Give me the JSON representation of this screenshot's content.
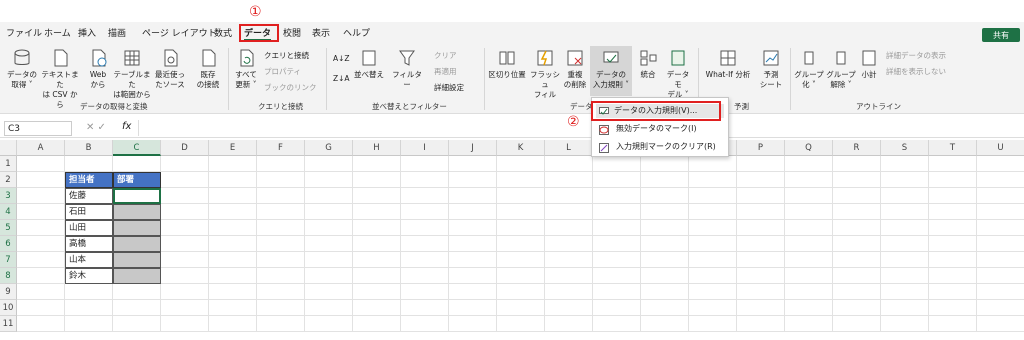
{
  "annotations": {
    "step1": "①",
    "step2": "②"
  },
  "menu": [
    "ファイル",
    "ホーム",
    "挿入",
    "描画",
    "ページ レイアウト",
    "数式",
    "データ",
    "校閲",
    "表示",
    "ヘルプ"
  ],
  "share_label": "共有",
  "ribbon": {
    "get_data": [
      "データの",
      "取得 ˅"
    ],
    "text_csv": [
      "テキストまた",
      "は CSV から"
    ],
    "web": [
      "Web",
      "から"
    ],
    "table_range": [
      "テーブルまた",
      "は範囲から"
    ],
    "recent": [
      "最近使っ",
      "たソース"
    ],
    "existing": [
      "既存",
      "の接続"
    ],
    "refresh": [
      "すべて",
      "更新 ˅"
    ],
    "queries": "クエリと接続",
    "properties": "プロパティ",
    "workbook_links": "ブックのリンク",
    "sort_az": "A↓Z",
    "sort_za": "Z↓A",
    "sort": "並べ替え",
    "filter": "フィルター",
    "clear": "クリア",
    "reapply": "再適用",
    "advanced": "詳細設定",
    "text_to_columns": "区切り位置",
    "flash_fill": [
      "フラッシュ",
      "フィル"
    ],
    "remove_dup": [
      "重複",
      "の削除"
    ],
    "validation": [
      "データの",
      "入力規則 ˅"
    ],
    "consolidate": "統合",
    "data_model": [
      "データ モ",
      "デル ˅"
    ],
    "whatif": "What-If 分析",
    "forecast": [
      "予測",
      "シート"
    ],
    "group": [
      "グループ",
      "化 ˅"
    ],
    "ungroup": [
      "グループ",
      "解除 ˅"
    ],
    "subtotal": "小計",
    "show_detail": "詳細データの表示",
    "hide_detail": "詳細を表示しない",
    "groups": {
      "get_transform": "データの取得と変換",
      "queries_conn": "クエリと接続",
      "sort_filter": "並べ替えとフィルター",
      "data_tools": "データ",
      "forecast": "予測",
      "outline": "アウトライン"
    }
  },
  "dropdown": [
    "データの入力規則(V)...",
    "無効データのマーク(I)",
    "入力規則マークのクリア(R)"
  ],
  "formula_bar": {
    "name_box": "C3",
    "fx": "fx"
  },
  "columns": [
    "A",
    "B",
    "C",
    "D",
    "E",
    "F",
    "G",
    "H",
    "I",
    "J",
    "K",
    "L",
    "M",
    "N",
    "O",
    "P",
    "Q",
    "R",
    "S",
    "T",
    "U"
  ],
  "rows": [
    "1",
    "2",
    "3",
    "4",
    "5",
    "6",
    "7",
    "8",
    "9",
    "10",
    "11"
  ],
  "table": {
    "headers": [
      "担当者",
      "部署"
    ],
    "names": [
      "佐藤",
      "石田",
      "山田",
      "高橋",
      "山本",
      "鈴木"
    ]
  },
  "colors": {
    "header_fill": "#4472c4",
    "gray_fill": "#c8c8c8",
    "accent": "#1e7145",
    "highlight": "#e02020"
  }
}
